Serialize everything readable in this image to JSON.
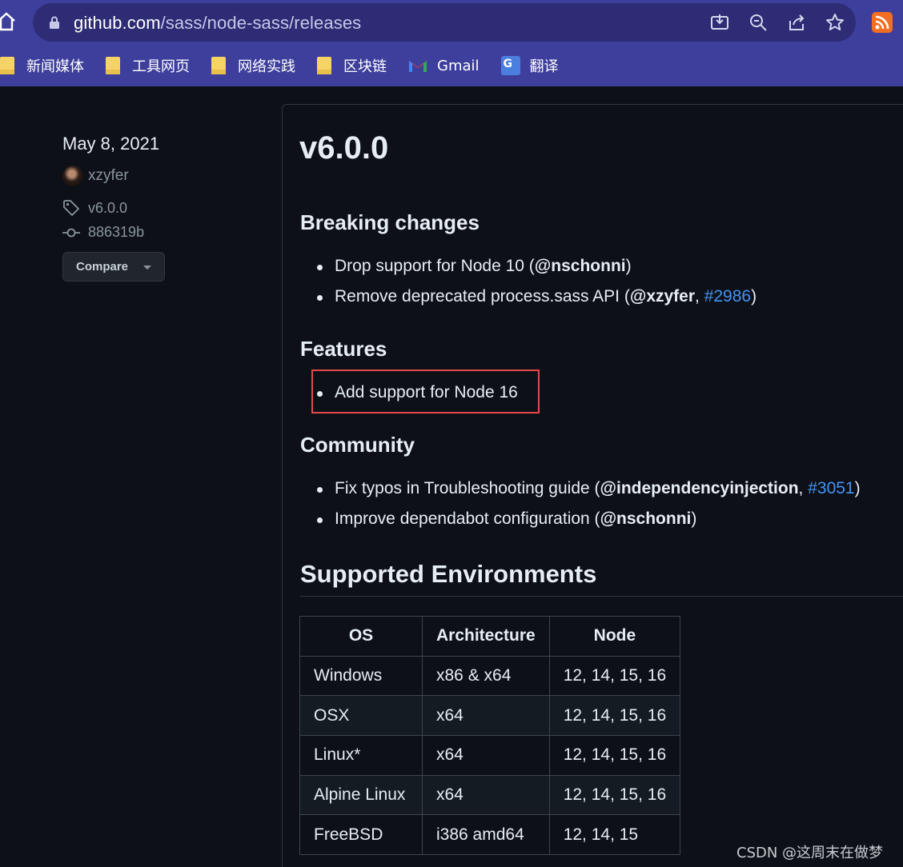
{
  "browser": {
    "url_host": "github.com",
    "url_path": "/sass/node-sass/releases",
    "bookmarks": [
      {
        "label": "新闻媒体",
        "icon": "folder-icon"
      },
      {
        "label": "工具网页",
        "icon": "folder-icon"
      },
      {
        "label": "网络实践",
        "icon": "folder-icon"
      },
      {
        "label": "区块链",
        "icon": "folder-icon"
      },
      {
        "label": "Gmail",
        "icon": "gmail-icon"
      },
      {
        "label": "翻译",
        "icon": "google-translate-icon"
      }
    ]
  },
  "sidebar": {
    "date": "May 8, 2021",
    "author": "xzyfer",
    "tag": "v6.0.0",
    "commit": "886319b",
    "compare_label": "Compare"
  },
  "release": {
    "title": "v6.0.0",
    "sections": {
      "breaking": {
        "heading": "Breaking changes",
        "items": [
          {
            "text": "Drop support for Node 10 (",
            "mention": "@nschonni",
            "sep": "",
            "issue": "",
            "end": ")"
          },
          {
            "text": "Remove deprecated process.sass API (",
            "mention": "@xzyfer",
            "sep": ", ",
            "issue": "#2986",
            "end": ")"
          }
        ]
      },
      "features": {
        "heading": "Features",
        "items": [
          {
            "text": "Add support for Node 16"
          }
        ]
      },
      "community": {
        "heading": "Community",
        "items": [
          {
            "text": "Fix typos in Troubleshooting guide (",
            "mention": "@independencyinjection",
            "sep": ", ",
            "issue": "#3051",
            "end": ")"
          },
          {
            "text": "Improve dependabot configuration (",
            "mention": "@nschonni",
            "sep": "",
            "issue": "",
            "end": ")"
          }
        ]
      }
    },
    "environments": {
      "heading": "Supported Environments",
      "columns": [
        "OS",
        "Architecture",
        "Node"
      ],
      "rows": [
        [
          "Windows",
          "x86 & x64",
          "12, 14, 15, 16"
        ],
        [
          "OSX",
          "x64",
          "12, 14, 15, 16"
        ],
        [
          "Linux*",
          "x64",
          "12, 14, 15, 16"
        ],
        [
          "Alpine Linux",
          "x64",
          "12, 14, 15, 16"
        ],
        [
          "FreeBSD",
          "i386 amd64",
          "12, 14, 15"
        ]
      ]
    }
  },
  "watermark": "CSDN @这周末在做梦",
  "colors": {
    "chrome": "#3e3f9c",
    "page_bg": "#0d1117",
    "link": "#4493f8",
    "highlight": "#e5484d"
  }
}
